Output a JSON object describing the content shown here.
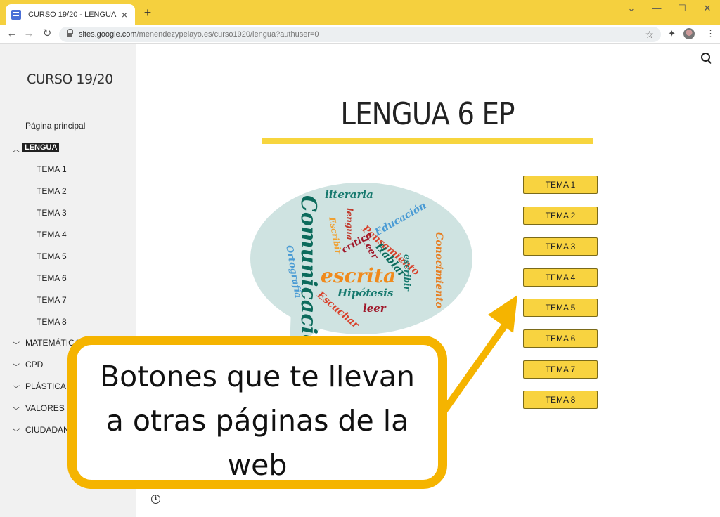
{
  "browser": {
    "tab_title": "CURSO 19/20 - LENGUA",
    "new_tab_symbol": "+",
    "url_host": "sites.google.com",
    "url_path": "/menendezypelayo.es/curso1920/lengua?authuser=0",
    "window_controls": [
      "⌄",
      "—",
      "☐",
      "✕"
    ]
  },
  "sidebar": {
    "site_title": "CURSO 19/20",
    "home": "Página principal",
    "active_section": "LENGUA",
    "subitems": [
      "TEMA 1",
      "TEMA 2",
      "TEMA 3",
      "TEMA 4",
      "TEMA 5",
      "TEMA 6",
      "TEMA 7",
      "TEMA 8"
    ],
    "sections": [
      "MATEMÁTICAS",
      "CPD",
      "PLÁSTICA",
      "VALORES 6",
      "CIUDADANÍA"
    ]
  },
  "main": {
    "title": "LENGUA 6 EP",
    "buttons": [
      "TEMA 1",
      "TEMA 2",
      "TEMA 3",
      "TEMA 4",
      "TEMA 5",
      "TEMA 6",
      "TEMA 7",
      "TEMA 8"
    ]
  },
  "word_cloud": {
    "words": [
      "literaria",
      "Comunicación",
      "Educación",
      "Pensamiento",
      "lengua",
      "Conocimiento",
      "Escribir",
      "Leer",
      "Hablar",
      "crítico",
      "escribir",
      "Ortografía",
      "escrita",
      "Hipótesis",
      "Escuchar",
      "leer"
    ]
  },
  "callout": {
    "lines": [
      "Botones que te llevan",
      "a otras páginas de la",
      "web"
    ]
  },
  "colors": {
    "accent": "#f8d340",
    "callout_border": "#f5b400",
    "browser_frame": "#f5d03e"
  }
}
